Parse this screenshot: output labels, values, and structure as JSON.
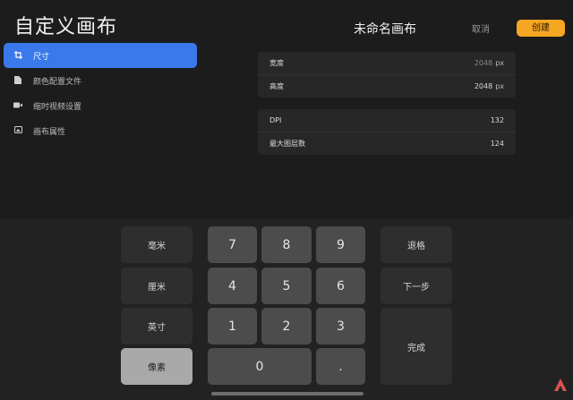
{
  "header": {
    "title": "自定义画布",
    "canvas_name": "未命名画布",
    "cancel_label": "取消",
    "create_label": "创建",
    "accent_color": "#f5a623"
  },
  "sidebar": {
    "items": [
      {
        "label": "尺寸",
        "icon": "crop-icon",
        "active": true
      },
      {
        "label": "颜色配置文件",
        "icon": "file-icon",
        "active": false
      },
      {
        "label": "缩时视频设置",
        "icon": "video-icon",
        "active": false
      },
      {
        "label": "画布属性",
        "icon": "canvas-icon",
        "active": false
      }
    ],
    "active_color": "#3a79ea"
  },
  "dimensions": {
    "width_label": "宽度",
    "width_value": "2048",
    "width_unit": "px",
    "height_label": "高度",
    "height_value": "2048",
    "height_unit": "px"
  },
  "properties": {
    "dpi_label": "DPI",
    "dpi_value": "132",
    "layers_label": "最大图层数",
    "layers_value": "124"
  },
  "keypad": {
    "units": [
      "毫米",
      "厘米",
      "英寸",
      "像素"
    ],
    "selected_unit": "像素",
    "digits": [
      "7",
      "8",
      "9",
      "4",
      "5",
      "6",
      "1",
      "2",
      "3"
    ],
    "zero": "0",
    "dot": ".",
    "backspace_label": "退格",
    "next_label": "下一步",
    "done_label": "完成"
  }
}
